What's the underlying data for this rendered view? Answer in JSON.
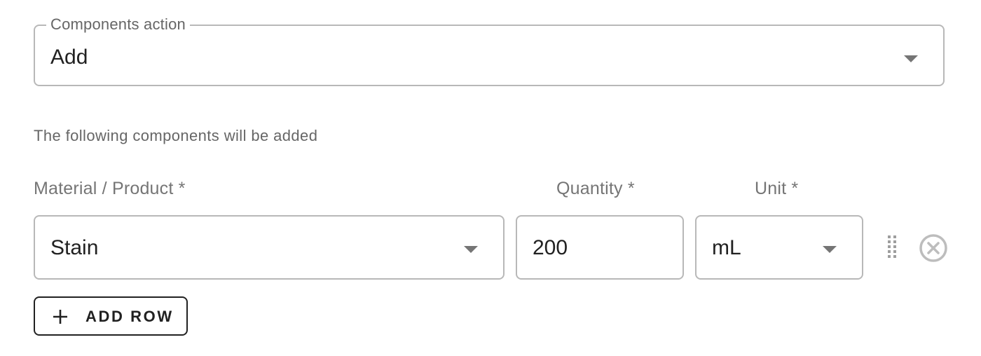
{
  "components_action": {
    "label": "Components action",
    "value": "Add"
  },
  "helper_text": "The following components will be added",
  "columns": {
    "material": "Material / Product *",
    "quantity": "Quantity *",
    "unit": "Unit *"
  },
  "rows": [
    {
      "material": "Stain",
      "quantity": "200",
      "unit": "mL"
    }
  ],
  "add_row": {
    "label": "ADD ROW",
    "icon": "plus-icon"
  },
  "icons": {
    "dropdown": "chevron-down-icon",
    "drag": "drag-handle-icon",
    "remove": "close-circle-icon"
  },
  "colors": {
    "border": "#b8b8b8",
    "label": "#757575",
    "text": "#212121",
    "icon": "#bdbdbd"
  }
}
